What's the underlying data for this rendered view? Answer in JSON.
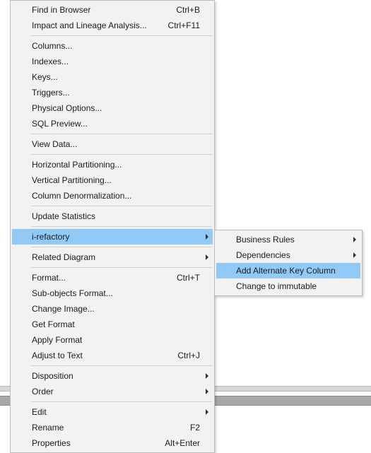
{
  "mainMenu": {
    "groups": [
      [
        {
          "label": "Find in Browser",
          "shortcut": "Ctrl+B",
          "submenu": false,
          "highlight": false,
          "name": "item-find-in-browser"
        },
        {
          "label": "Impact and Lineage Analysis...",
          "shortcut": "Ctrl+F11",
          "submenu": false,
          "highlight": false,
          "name": "item-impact-lineage"
        }
      ],
      [
        {
          "label": "Columns...",
          "shortcut": "",
          "submenu": false,
          "highlight": false,
          "name": "item-columns"
        },
        {
          "label": "Indexes...",
          "shortcut": "",
          "submenu": false,
          "highlight": false,
          "name": "item-indexes"
        },
        {
          "label": "Keys...",
          "shortcut": "",
          "submenu": false,
          "highlight": false,
          "name": "item-keys"
        },
        {
          "label": "Triggers...",
          "shortcut": "",
          "submenu": false,
          "highlight": false,
          "name": "item-triggers"
        },
        {
          "label": "Physical Options...",
          "shortcut": "",
          "submenu": false,
          "highlight": false,
          "name": "item-physical-options"
        },
        {
          "label": "SQL Preview...",
          "shortcut": "",
          "submenu": false,
          "highlight": false,
          "name": "item-sql-preview"
        }
      ],
      [
        {
          "label": "View Data...",
          "shortcut": "",
          "submenu": false,
          "highlight": false,
          "name": "item-view-data"
        }
      ],
      [
        {
          "label": "Horizontal Partitioning...",
          "shortcut": "",
          "submenu": false,
          "highlight": false,
          "name": "item-horizontal-partitioning"
        },
        {
          "label": "Vertical Partitioning...",
          "shortcut": "",
          "submenu": false,
          "highlight": false,
          "name": "item-vertical-partitioning"
        },
        {
          "label": "Column Denormalization...",
          "shortcut": "",
          "submenu": false,
          "highlight": false,
          "name": "item-column-denormalization"
        }
      ],
      [
        {
          "label": "Update Statistics",
          "shortcut": "",
          "submenu": false,
          "highlight": false,
          "name": "item-update-statistics"
        }
      ],
      [
        {
          "label": "i-refactory",
          "shortcut": "",
          "submenu": true,
          "highlight": true,
          "name": "item-i-refactory"
        }
      ],
      [
        {
          "label": "Related Diagram",
          "shortcut": "",
          "submenu": true,
          "highlight": false,
          "name": "item-related-diagram"
        }
      ],
      [
        {
          "label": "Format...",
          "shortcut": "Ctrl+T",
          "submenu": false,
          "highlight": false,
          "name": "item-format"
        },
        {
          "label": "Sub-objects Format...",
          "shortcut": "",
          "submenu": false,
          "highlight": false,
          "name": "item-subobjects-format"
        },
        {
          "label": "Change Image...",
          "shortcut": "",
          "submenu": false,
          "highlight": false,
          "name": "item-change-image"
        },
        {
          "label": "Get Format",
          "shortcut": "",
          "submenu": false,
          "highlight": false,
          "name": "item-get-format"
        },
        {
          "label": "Apply Format",
          "shortcut": "",
          "submenu": false,
          "highlight": false,
          "name": "item-apply-format"
        },
        {
          "label": "Adjust to Text",
          "shortcut": "Ctrl+J",
          "submenu": false,
          "highlight": false,
          "name": "item-adjust-to-text"
        }
      ],
      [
        {
          "label": "Disposition",
          "shortcut": "",
          "submenu": true,
          "highlight": false,
          "name": "item-disposition"
        },
        {
          "label": "Order",
          "shortcut": "",
          "submenu": true,
          "highlight": false,
          "name": "item-order"
        }
      ],
      [
        {
          "label": "Edit",
          "shortcut": "",
          "submenu": true,
          "highlight": false,
          "name": "item-edit"
        },
        {
          "label": "Rename",
          "shortcut": "F2",
          "submenu": false,
          "highlight": false,
          "name": "item-rename"
        },
        {
          "label": "Properties",
          "shortcut": "Alt+Enter",
          "submenu": false,
          "highlight": false,
          "name": "item-properties"
        }
      ]
    ]
  },
  "subMenu": {
    "items": [
      {
        "label": "Business Rules",
        "shortcut": "",
        "submenu": true,
        "highlight": false,
        "name": "subitem-business-rules"
      },
      {
        "label": "Dependencies",
        "shortcut": "",
        "submenu": true,
        "highlight": false,
        "name": "subitem-dependencies"
      },
      {
        "label": "Add Alternate Key Column",
        "shortcut": "",
        "submenu": false,
        "highlight": true,
        "name": "subitem-add-alternate-key-column"
      },
      {
        "label": "Change to immutable",
        "shortcut": "",
        "submenu": false,
        "highlight": false,
        "name": "subitem-change-to-immutable"
      }
    ]
  },
  "colors": {
    "highlight": "#91c9f7",
    "menuBg": "#f2f2f2",
    "border": "#bcbcbc"
  }
}
